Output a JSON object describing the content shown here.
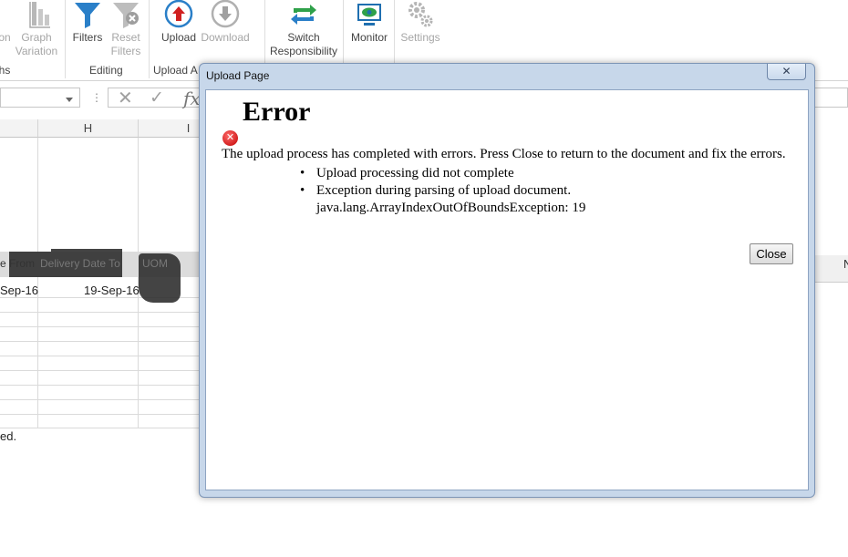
{
  "ribbon": {
    "buttons": {
      "partial_left": "on",
      "graph_variation_1": "Graph",
      "graph_variation_2": "Variation",
      "filters": "Filters",
      "reset_filters_1": "Reset",
      "reset_filters_2": "Filters",
      "upload": "Upload",
      "download": "Download",
      "switch_1": "Switch",
      "switch_2": "Responsibility",
      "monitor": "Monitor",
      "settings": "Settings"
    },
    "groups": {
      "graphs_partial": "ohs",
      "editing": "Editing",
      "upload_partial": "Upload A"
    }
  },
  "formula_bar": {
    "dots": "⋮",
    "cancel": "✕",
    "enter": "✓",
    "fx": "fx"
  },
  "sheet": {
    "columns": [
      "H",
      "I"
    ],
    "header_row": [
      "e From",
      "Delivery Date To",
      "UOM"
    ],
    "data_row": [
      "Sep-16",
      "19-Sep-16"
    ],
    "right_col_partial": "N",
    "status_fragment": "ed."
  },
  "dialog": {
    "title": "Upload Page",
    "close_x": "✕",
    "heading": "Error",
    "message": "The upload process has completed with errors. Press Close to return to the document and fix the errors.",
    "errors": [
      "Upload processing did not complete",
      "Exception during parsing of upload document.",
      "java.lang.ArrayIndexOutOfBoundsException: 19"
    ],
    "close_label": "Close"
  }
}
